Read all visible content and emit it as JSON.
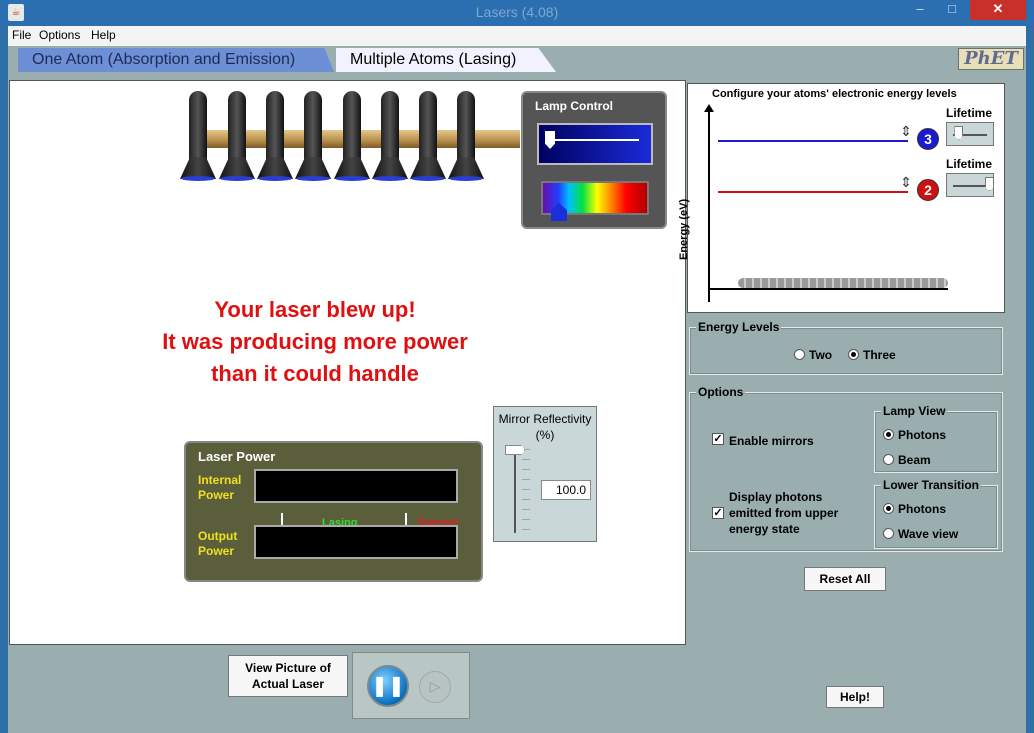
{
  "window": {
    "title": "Lasers (4.08)",
    "icon": "java-icon",
    "close_label": "✕",
    "min_label": "–",
    "max_label": "□"
  },
  "menu": {
    "file": "File",
    "options": "Options",
    "help": "Help"
  },
  "tabs": {
    "one_atom": "One Atom (Absorption and Emission)",
    "multiple_atoms": "Multiple Atoms (Lasing)",
    "active": "multiple_atoms"
  },
  "logo": {
    "text": "PhET"
  },
  "lamp_control": {
    "title": "Lamp Control"
  },
  "message": {
    "line1": "Your laser blew up!",
    "line2": "It was producing more power",
    "line3": "than it could handle",
    "color": "#e01010"
  },
  "laser_power": {
    "title": "Laser Power",
    "internal_label": "Internal Power",
    "output_label": "Output Power",
    "lasing_label": "Lasing",
    "danger_label": "Danger!"
  },
  "mirror": {
    "title": "Mirror Reflectivity (%)",
    "value": "100.0"
  },
  "energy_diagram": {
    "title": "Configure your atoms' electronic energy levels",
    "axis_label": "Energy (eV)",
    "lifetime_label": "Lifetime",
    "level3_badge": "3",
    "level2_badge": "2",
    "level3_color": "#1a1ad0",
    "level2_color": "#d01010",
    "level3_lifetime": 0.1,
    "level2_lifetime": 1.0
  },
  "energy_levels": {
    "legend": "Energy Levels",
    "two": "Two",
    "three": "Three",
    "selected": "three"
  },
  "options": {
    "legend": "Options",
    "enable_mirrors": "Enable mirrors",
    "display_photons_line1": "Display photons",
    "display_photons_line2": "emitted from upper",
    "display_photons_line3": "energy state",
    "lamp_view_legend": "Lamp View",
    "lamp_view_photons": "Photons",
    "lamp_view_beam": "Beam",
    "lower_transition_legend": "Lower Transition",
    "lower_photons": "Photons",
    "lower_wave": "Wave view"
  },
  "buttons": {
    "reset_all": "Reset All",
    "help": "Help!",
    "view_picture_line1": "View Picture of",
    "view_picture_line2": "Actual Laser",
    "pause_icon": "❚❚",
    "step_icon": "▷"
  }
}
